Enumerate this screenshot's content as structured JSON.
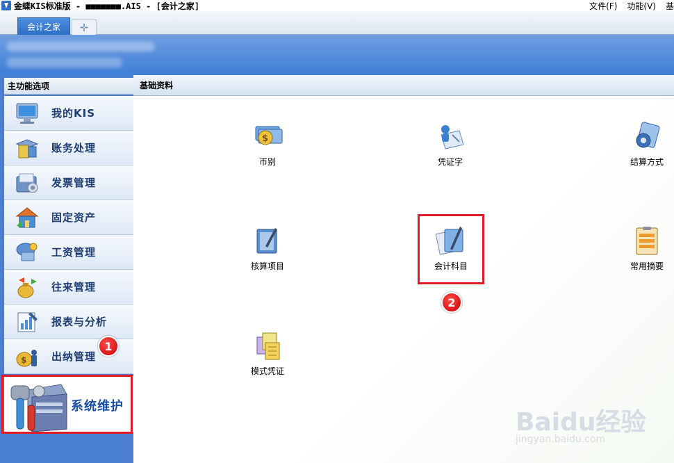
{
  "window": {
    "title": "金蝶KIS标准版 - ■■■■■■■.AIS - [会计之家]",
    "menus": [
      "文件(F)",
      "功能(V)",
      "基"
    ]
  },
  "tabs": {
    "active": "会计之家",
    "add_symbol": "✛"
  },
  "sidebar": {
    "header": "主功能选项",
    "items": [
      {
        "label": "我的KIS",
        "icon": "monitor-icon"
      },
      {
        "label": "账务处理",
        "icon": "ledger-icon"
      },
      {
        "label": "发票管理",
        "icon": "invoice-folder-icon"
      },
      {
        "label": "固定资产",
        "icon": "house-icon"
      },
      {
        "label": "工资管理",
        "icon": "salary-icon"
      },
      {
        "label": "往来管理",
        "icon": "money-bag-arrows-icon"
      },
      {
        "label": "报表与分析",
        "icon": "report-icon"
      },
      {
        "label": "出纳管理",
        "icon": "cashier-bag-icon"
      }
    ],
    "selected": {
      "label": "系统维护",
      "icon": "server-tools-icon"
    }
  },
  "content": {
    "header": "基础资料",
    "items": [
      {
        "label": "币别",
        "icon": "currency-icon"
      },
      {
        "label": "凭证字",
        "icon": "voucher-word-icon"
      },
      {
        "label": "结算方式",
        "icon": "settlement-icon"
      },
      {
        "label": "核算项目",
        "icon": "accounting-item-icon"
      },
      {
        "label": "会计科目",
        "icon": "account-subject-icon"
      },
      {
        "label": "常用摘要",
        "icon": "common-summary-icon"
      },
      {
        "label": "模式凭证",
        "icon": "voucher-template-icon"
      }
    ]
  },
  "annotations": {
    "step1": "1",
    "step2": "2"
  },
  "watermark": {
    "text": "Baidu经验",
    "sub": "jingyan.baidu.com"
  },
  "colors": {
    "accent": "#3f7fd8",
    "highlight": "#e01d27",
    "nav_text": "#1e3e73"
  }
}
